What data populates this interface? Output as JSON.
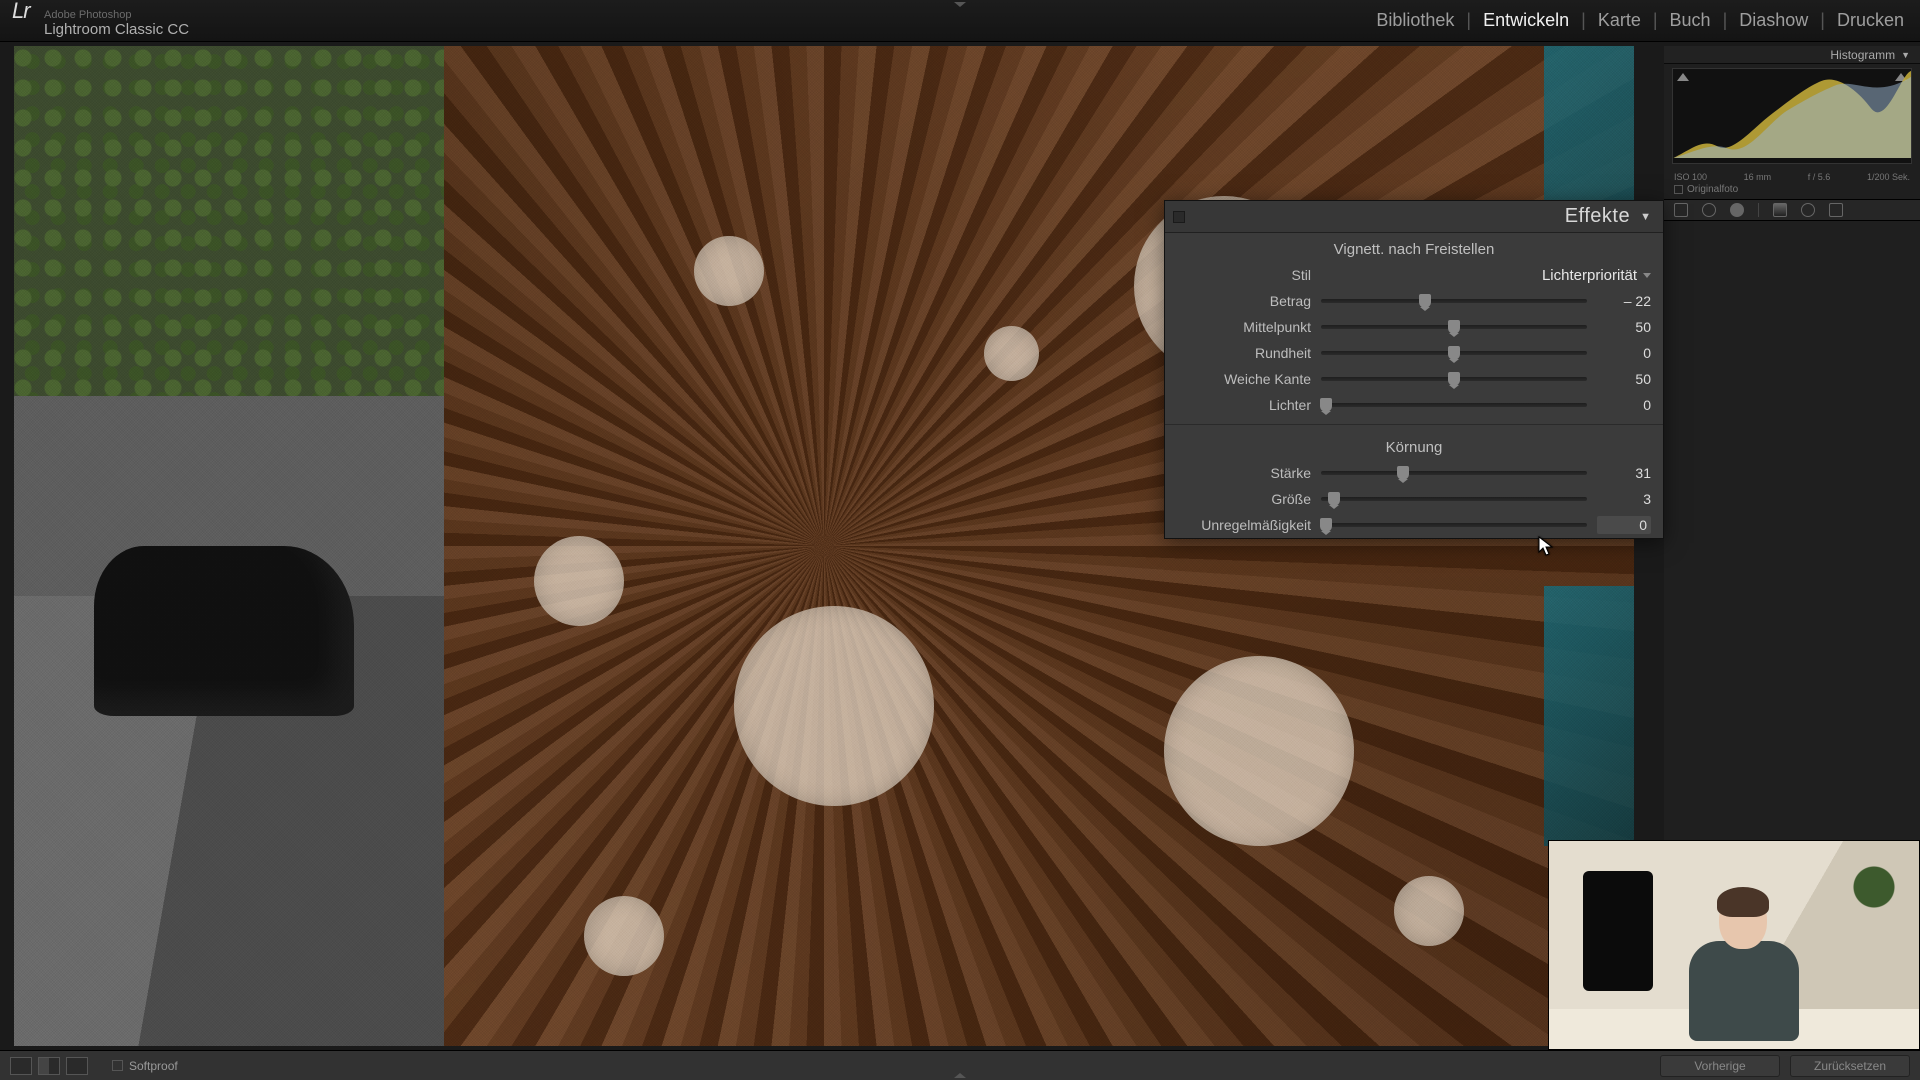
{
  "app": {
    "vendor": "Adobe Photoshop",
    "name": "Lightroom Classic CC",
    "logo_text": "Lr"
  },
  "modules": {
    "items": [
      "Bibliothek",
      "Entwickeln",
      "Karte",
      "Buch",
      "Diashow",
      "Drucken"
    ],
    "active_index": 1
  },
  "histogram": {
    "title": "Histogramm",
    "meta": {
      "iso": "ISO 100",
      "focal": "16 mm",
      "aperture": "f / 5.6",
      "shutter": "1/200 Sek."
    },
    "original_label": "Originalfoto"
  },
  "panel": {
    "title": "Effekte",
    "vignette": {
      "heading": "Vignett. nach Freistellen",
      "style_label": "Stil",
      "style_value": "Lichterpriorität",
      "sliders": [
        {
          "label": "Betrag",
          "value": "– 22",
          "pos": 39
        },
        {
          "label": "Mittelpunkt",
          "value": "50",
          "pos": 50
        },
        {
          "label": "Rundheit",
          "value": "0",
          "pos": 50
        },
        {
          "label": "Weiche Kante",
          "value": "50",
          "pos": 50
        },
        {
          "label": "Lichter",
          "value": "0",
          "pos": 2
        }
      ]
    },
    "grain": {
      "heading": "Körnung",
      "sliders": [
        {
          "label": "Stärke",
          "value": "31",
          "pos": 31
        },
        {
          "label": "Größe",
          "value": "3",
          "pos": 5
        },
        {
          "label": "Unregelmäßigkeit",
          "value": "0",
          "pos": 2,
          "highlight": true
        }
      ]
    }
  },
  "bottombar": {
    "softproof": "Softproof",
    "prev": "Vorherige",
    "reset": "Zurücksetzen"
  }
}
